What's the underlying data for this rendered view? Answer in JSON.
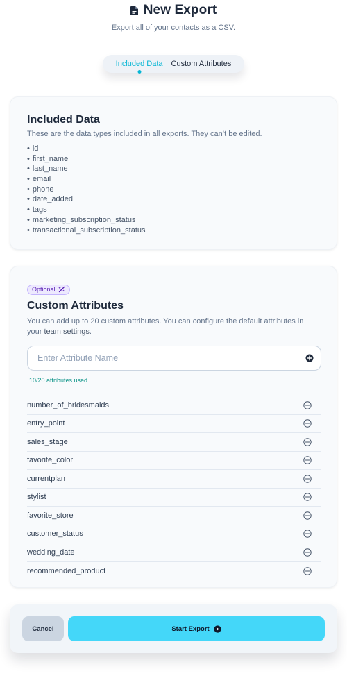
{
  "header": {
    "icon": "document-icon",
    "title": "New Export",
    "subtitle": "Export all of your contacts as a CSV."
  },
  "tabs": [
    {
      "label": "Included Data",
      "active": true
    },
    {
      "label": "Custom Attributes",
      "active": false
    }
  ],
  "included": {
    "title": "Included Data",
    "description": "These are the data types included in all exports. They can’t be edited.",
    "items": [
      "id",
      "first_name",
      "last_name",
      "email",
      "phone",
      "date_added",
      "tags",
      "marketing_subscription_status",
      "transactional_subscription_status"
    ]
  },
  "custom": {
    "badge": "Optional",
    "badge_icon": "magic-wand-icon",
    "title": "Custom Attributes",
    "description_prefix": "You can add up to 20 custom attributes. You can configure the default attributes in your ",
    "link_text": "team settings",
    "description_suffix": ".",
    "input": {
      "value": "",
      "placeholder": "Enter Attribute Name"
    },
    "usage": "10/20 attributes used",
    "attributes": [
      "number_of_bridesmaids",
      "entry_point",
      "sales_stage",
      "favorite_color",
      "currentplan",
      "stylist",
      "favorite_store",
      "customer_status",
      "wedding_date",
      "recommended_product"
    ]
  },
  "footer": {
    "cancel_label": "Cancel",
    "start_label": "Start Export"
  },
  "colors": {
    "accent": "#06b6d4",
    "primary_button": "#44d7f9",
    "cancel_button": "#cbd5e1",
    "badge_bg": "#ede9fe",
    "usage_text": "#0d9488"
  }
}
